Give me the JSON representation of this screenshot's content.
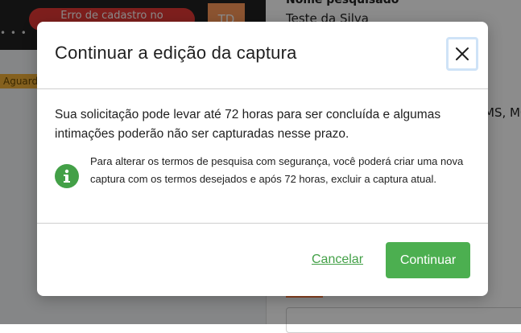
{
  "background": {
    "topbar_dots": "• • •",
    "error_pill": "Erro de cadastro no",
    "avatar_initials": "TD",
    "status_badge": "Aguard",
    "field_label": "Nome pesquisado",
    "field_value": "Teste da Silva",
    "states_fragment": "MS, MG"
  },
  "modal": {
    "title": "Continuar a edição da captura",
    "close_icon": "close-icon",
    "main_text": "Sua solicitação pode levar até 72 horas para ser concluída e algumas intimações poderão não ser capturadas nesse prazo.",
    "info_icon": "info-icon",
    "info_text": "Para alterar os termos de pesquisa com segurança, você poderá criar uma nova captura com os termos desejados e após 72 horas, excluir a captura atual.",
    "cancel_label": "Cancelar",
    "continue_label": "Continuar"
  },
  "colors": {
    "accent_green": "#4caf50",
    "link_green": "#43a047",
    "overlay": "rgba(0,0,0,0.45)",
    "error_red": "#e53935",
    "avatar_orange": "#ff9a5a",
    "badge_yellow": "#f2b13a"
  }
}
